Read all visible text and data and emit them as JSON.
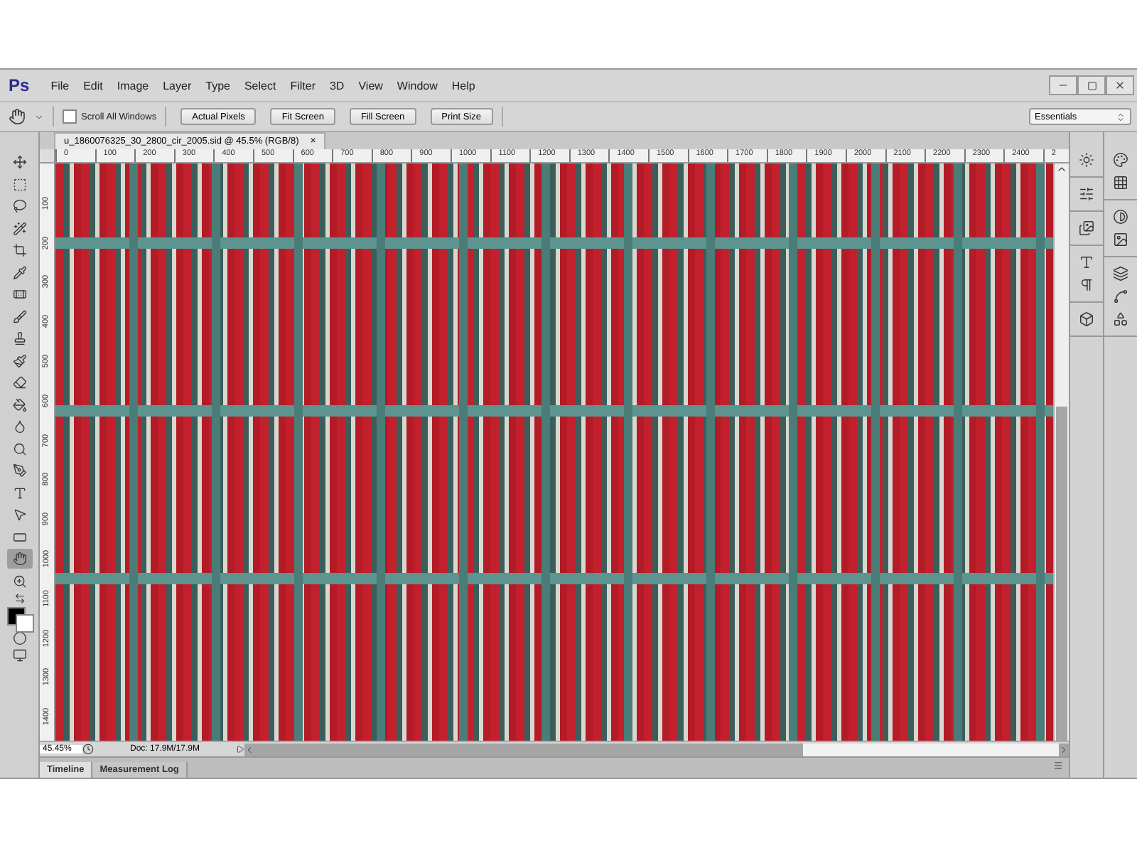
{
  "app_logo": "Ps",
  "menu": [
    "File",
    "Edit",
    "Image",
    "Layer",
    "Type",
    "Select",
    "Filter",
    "3D",
    "View",
    "Window",
    "Help"
  ],
  "options_bar": {
    "scroll_all_windows": {
      "label": "Scroll All Windows",
      "checked": false
    },
    "buttons": [
      "Actual Pixels",
      "Fit Screen",
      "Fill Screen",
      "Print Size"
    ],
    "workspace": "Essentials"
  },
  "document_tab": {
    "title": "u_1860076325_30_2800_cir_2005.sid @ 45.5% (RGB/8)",
    "close": "×"
  },
  "ruler": {
    "horizontal": [
      "0",
      "100",
      "200",
      "300",
      "400",
      "500",
      "600",
      "700",
      "800",
      "900",
      "1000",
      "1100",
      "1200",
      "1300",
      "1400",
      "1500",
      "1600",
      "1700",
      "1800",
      "1900",
      "2000",
      "2100",
      "2200",
      "2300",
      "2400",
      "2"
    ],
    "vertical": [
      "100",
      "200",
      "300",
      "400",
      "500",
      "600",
      "700",
      "800",
      "900",
      "1000",
      "1100",
      "1200",
      "1300",
      "1400"
    ]
  },
  "tools": [
    {
      "selected": false
    },
    {
      "selected": false
    },
    {
      "selected": false
    },
    {
      "selected": false
    },
    {
      "selected": false
    },
    {
      "selected": false
    },
    {
      "selected": false
    },
    {
      "selected": false
    },
    {
      "selected": false
    },
    {
      "selected": false
    },
    {
      "selected": false
    },
    {
      "selected": false
    },
    {
      "selected": false
    },
    {
      "selected": false
    },
    {
      "selected": false
    },
    {
      "selected": false
    },
    {
      "selected": false
    },
    {
      "selected": false
    },
    {
      "selected": true
    },
    {
      "selected": false
    }
  ],
  "status_bar": {
    "zoom": "45.45%",
    "doc_size": "Doc: 17.9M/17.9M"
  },
  "bottom_tabs": [
    {
      "label": "Timeline",
      "selected": true
    },
    {
      "label": "Measurement Log",
      "selected": false
    }
  ]
}
